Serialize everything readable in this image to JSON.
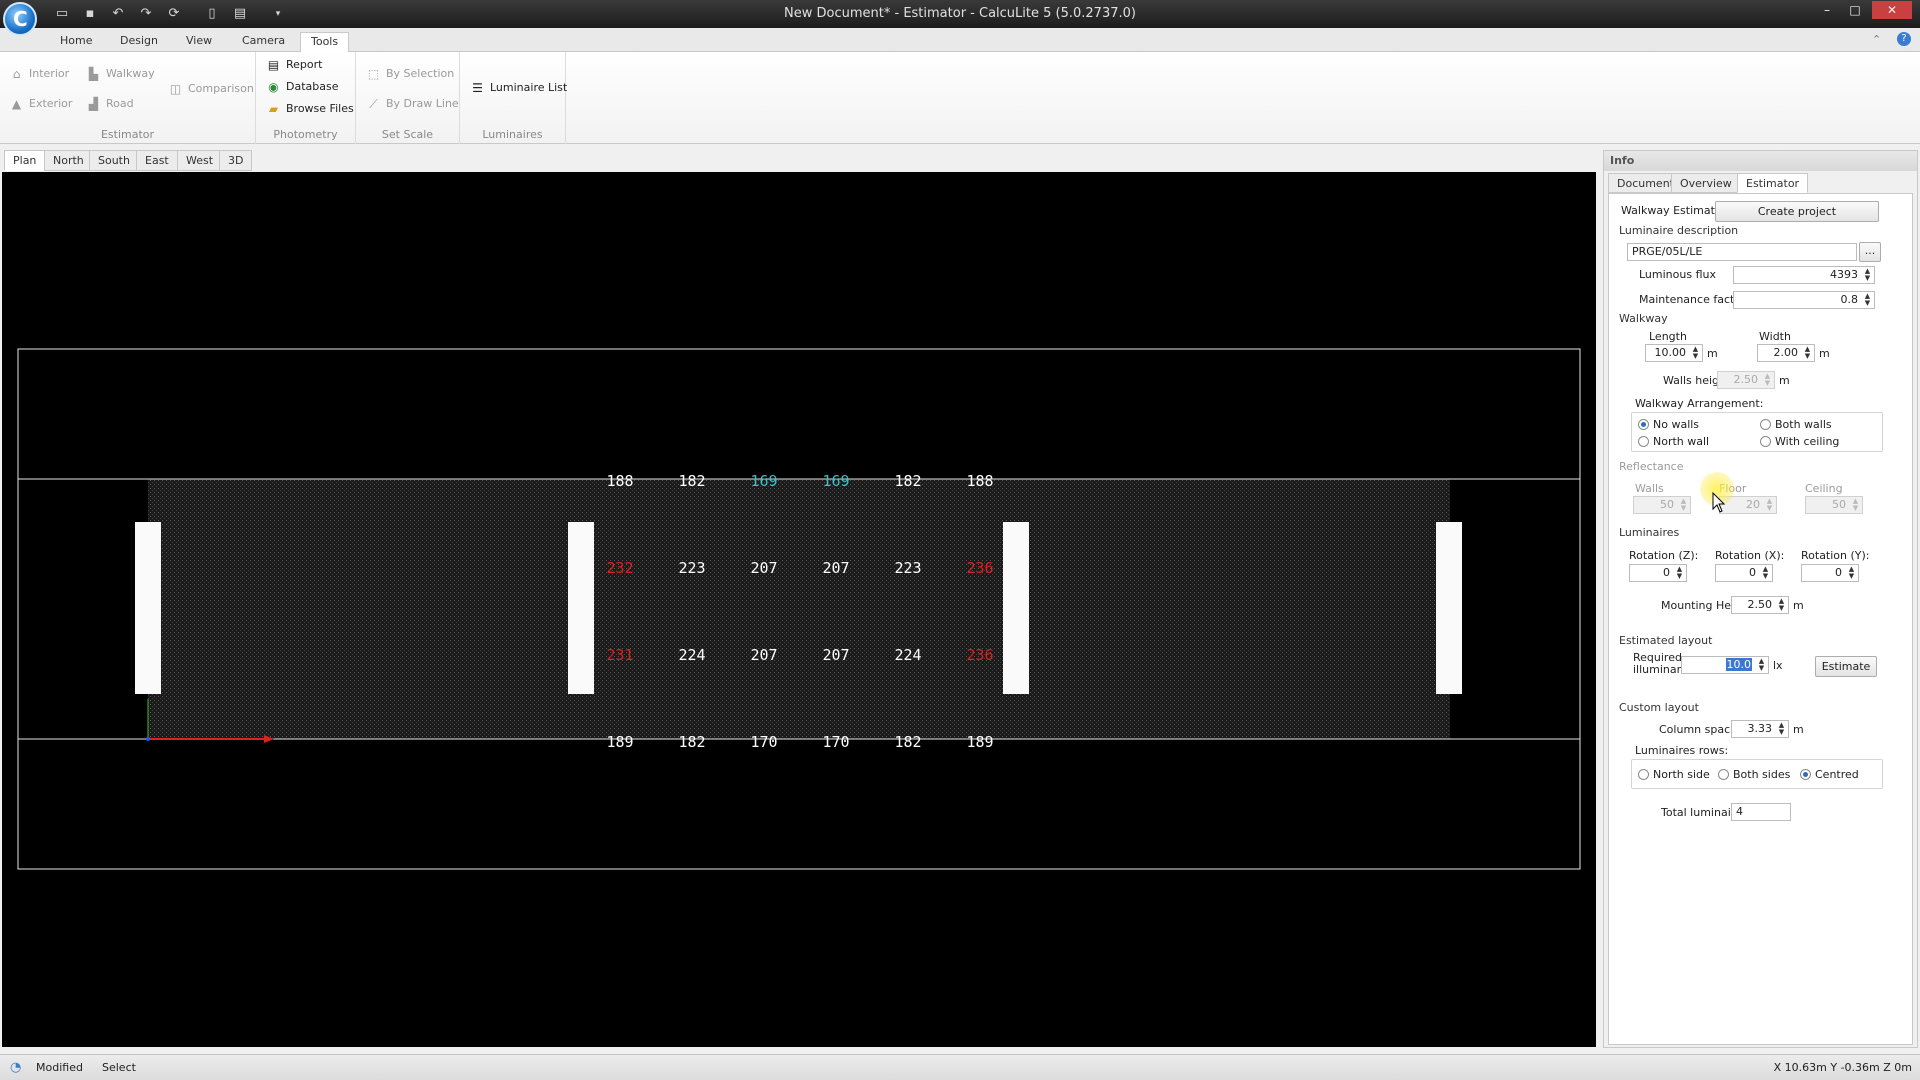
{
  "window": {
    "title": "New Document* - Estimator - CalcuLite 5 (5.0.2737.0)",
    "quick_access": [
      "open-icon",
      "save-icon",
      "undo-icon",
      "redo-icon",
      "refresh-icon",
      "new-icon",
      "export-icon",
      "dropdown-icon"
    ],
    "controls": {
      "minimize": "–",
      "maximize": "□",
      "close": "✕"
    }
  },
  "ribbon": {
    "tabs": [
      {
        "label": "Home",
        "active": false
      },
      {
        "label": "Design",
        "active": false
      },
      {
        "label": "View",
        "active": false
      },
      {
        "label": "Camera",
        "active": false
      },
      {
        "label": "Tools",
        "active": true
      }
    ],
    "groups": {
      "estimator": {
        "label": "Estimator",
        "interior": "Interior",
        "walkway": "Walkway",
        "comparison": "Comparison",
        "exterior": "Exterior",
        "road": "Road"
      },
      "photometry": {
        "label": "Photometry",
        "report": "Report",
        "database": "Database",
        "browse": "Browse Files"
      },
      "set_scale": {
        "label": "Set Scale",
        "by_selection": "By Selection",
        "by_draw_line": "By Draw Line"
      },
      "luminaires": {
        "label": "Luminaires",
        "luminaire_list": "Luminaire List"
      }
    }
  },
  "view_tabs": [
    {
      "label": "Plan",
      "active": true
    },
    {
      "label": "North",
      "active": false
    },
    {
      "label": "South",
      "active": false
    },
    {
      "label": "East",
      "active": false
    },
    {
      "label": "West",
      "active": false
    },
    {
      "label": "3D",
      "active": false
    }
  ],
  "plan": {
    "rows": [
      {
        "values": [
          "188",
          "182",
          "169",
          "169",
          "182",
          "188"
        ],
        "colors": [
          "#ffffff",
          "#ffffff",
          "#33c3c3",
          "#33c3c3",
          "#ffffff",
          "#ffffff"
        ]
      },
      {
        "values": [
          "232",
          "223",
          "207",
          "207",
          "223",
          "236"
        ],
        "colors": [
          "#e02020",
          "#ffffff",
          "#ffffff",
          "#ffffff",
          "#ffffff",
          "#e02020"
        ]
      },
      {
        "values": [
          "231",
          "224",
          "207",
          "207",
          "224",
          "236"
        ],
        "colors": [
          "#e02020",
          "#ffffff",
          "#ffffff",
          "#ffffff",
          "#ffffff",
          "#e02020"
        ]
      },
      {
        "values": [
          "189",
          "182",
          "170",
          "170",
          "182",
          "189"
        ],
        "colors": [
          "#ffffff",
          "#ffffff",
          "#ffffff",
          "#ffffff",
          "#ffffff",
          "#ffffff"
        ]
      }
    ]
  },
  "panel": {
    "title": "Info",
    "tabs": [
      {
        "label": "Document",
        "active": false
      },
      {
        "label": "Overview",
        "active": false
      },
      {
        "label": "Estimator",
        "active": true
      }
    ],
    "walkway_estimator": "Walkway Estimator",
    "create_project": "Create project",
    "luminaire_description_label": "Luminaire description",
    "luminaire_description": "PRGE/05L/LE",
    "browse_btn": "...",
    "luminous_flux_label": "Luminous flux",
    "luminous_flux": "4393",
    "maintenance_factor_label": "Maintenance factor",
    "maintenance_factor": "0.8",
    "walkway": {
      "section": "Walkway",
      "length_label": "Length",
      "length": "10.00",
      "width_label": "Width",
      "width": "2.00",
      "unit": "m",
      "walls_height_label": "Walls height",
      "walls_height": "2.50",
      "arrangement_label": "Walkway Arrangement:",
      "no_walls": "No walls",
      "both_walls": "Both walls",
      "north_wall": "North wall",
      "with_ceiling": "With ceiling"
    },
    "reflectance": {
      "section": "Reflectance",
      "walls_label": "Walls",
      "walls": "50",
      "floor_label": "Floor",
      "floor": "20",
      "ceiling_label": "Ceiling",
      "ceiling": "50"
    },
    "luminaires": {
      "section": "Luminaires",
      "rot_z_label": "Rotation (Z):",
      "rot_z": "0",
      "rot_x_label": "Rotation (X):",
      "rot_x": "0",
      "rot_y_label": "Rotation (Y):",
      "rot_y": "0",
      "mounting_height_label": "Mounting Height",
      "mounting_height": "2.50"
    },
    "estimated_layout": {
      "section": "Estimated layout",
      "required_label_1": "Required",
      "required_label_2": "illuminance",
      "required_value": "10.0",
      "unit": "lx",
      "estimate_btn": "Estimate"
    },
    "custom_layout": {
      "section": "Custom layout",
      "column_spacing_label": "Column spacing",
      "column_spacing": "3.33",
      "rows_label": "Luminaires rows:",
      "north_side": "North side",
      "both_sides": "Both sides",
      "centred": "Centred",
      "total_label": "Total luminaires",
      "total": "4"
    }
  },
  "status": {
    "modified": "Modified",
    "mode": "Select",
    "coords": "X 10.63m Y -0.36m Z 0m"
  }
}
